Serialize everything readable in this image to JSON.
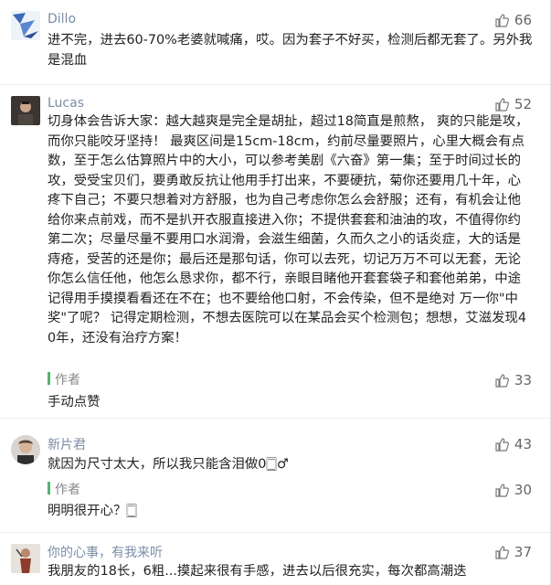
{
  "comments": [
    {
      "author": "Dillo",
      "likes": "66",
      "text": "进不完，进去60-70%老婆就喊痛，哎。因为套子不好买，检测后都无套了。另外我是混血"
    },
    {
      "author": "Lucas",
      "likes": "52",
      "text": "切身体会告诉大家：越大越爽是完全是胡扯，超过18简直是煎熬， 爽的只能是攻，而你只能咬牙坚持！ 最爽区间是15cm-18cm，约前尽量要照片，心里大概会有点数，至于怎么估算照片中的大小，可以参考美剧《六奋》第一集；至于时间过长的攻，受受宝贝们，要勇敢反抗让他用手打出来，不要硬抗，菊你还要用几十年，心疼下自己；不要只想着对方舒服，也为自己考虑你怎么会舒服；还有，有机会让他给你来点前戏，而不是扒开衣服直接进入你；不提供套套和油油的攻，不值得你约第二次；尽量尽量不要用口水润滑，会滋生细菌，久而久之小的话炎症，大的话是痔疮，受苦的还是你；最后还是那句话，你可以去死，切记万万不可以无套，无论你怎么信任他，他怎么恳求你，都不行，亲眼目睹他开套套袋子和套他弟弟，中途记得用手摸摸看看还在不在；也不要给他口射，不会传染，但不是绝对 万一你\"中奖\"了呢？ 记得定期检测，不想去医院可以在某品会买个检测包；想想，艾滋发现40年，还没有治疗方案！",
      "reply": {
        "label": "作者",
        "text": "手动点赞",
        "likes": "33"
      }
    },
    {
      "author": "新片君",
      "likes": "43",
      "text": "就因为尺寸太大，所以我只能含泪做0🀆♂",
      "reply": {
        "label": "作者",
        "text": "明明很开心？🀆",
        "likes": "30"
      }
    },
    {
      "author": "你的心事，有我来听",
      "likes": "37",
      "text": "我朋友的18长，6粗...摸起来很有手感，进去以后很充实，每次都高潮迭"
    }
  ]
}
